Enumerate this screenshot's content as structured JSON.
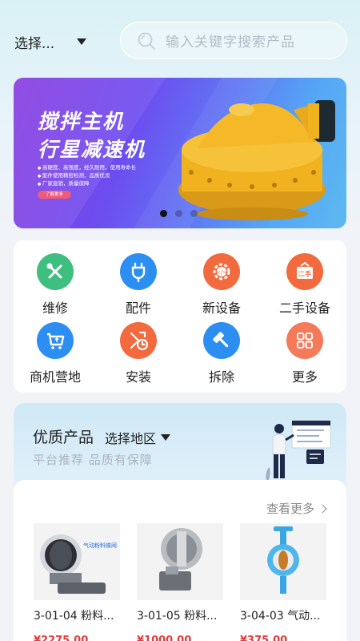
{
  "header": {
    "region_label": "选择...",
    "search_placeholder": "输入关键字搜索产品"
  },
  "banner": {
    "title_line1": "搅拌主机",
    "title_line2": "行星减速机",
    "bullets": [
      "高硬度、高强度，经久耐用，使用寿命长",
      "配件使用精密检测，品质优良",
      "厂家直销，质量保障"
    ],
    "button_label": "了解更多",
    "slide_count": 3,
    "active_slide": 1
  },
  "categories": [
    {
      "label": "维修",
      "color": "#3fbf7f",
      "icon": "wrench-screwdriver-icon"
    },
    {
      "label": "配件",
      "color": "#2d8ef2",
      "icon": "plug-icon"
    },
    {
      "label": "新设备",
      "color": "#f26a3d",
      "icon": "gear-code-icon"
    },
    {
      "label": "二手设备",
      "color": "#f26a3d",
      "icon": "second-hand-sign-icon"
    },
    {
      "label": "商机营地",
      "color": "#2d8ef2",
      "icon": "cart-icon"
    },
    {
      "label": "安装",
      "color": "#f26a3d",
      "icon": "tools-clock-icon"
    },
    {
      "label": "拆除",
      "color": "#2d8ef2",
      "icon": "hammer-icon"
    },
    {
      "label": "更多",
      "color": "#f47a5a",
      "icon": "grid-icon"
    }
  ],
  "quality": {
    "title": "优质产品",
    "region_label": "选择地区",
    "subtitle": "平台推荐   品质有保障",
    "more_label": "查看更多",
    "products": [
      {
        "name": "3-01-04 粉料...",
        "price": "¥2275.00"
      },
      {
        "name": "3-01-05 粉料...",
        "price": "¥1000.00"
      },
      {
        "name": "3-04-03 气动...",
        "price": "¥375.00"
      }
    ],
    "product_image_caption": "气动粉料蝶阀"
  }
}
